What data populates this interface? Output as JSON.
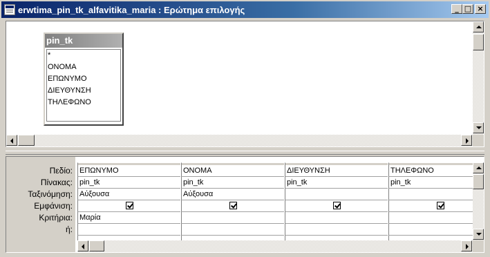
{
  "window": {
    "title": "erwtima_pin_tk_alfavitika_maria : Ερώτημα επιλογής",
    "minimize_label": "_",
    "maximize_label": "□",
    "close_label": "×"
  },
  "field_list": {
    "table_name": "pin_tk",
    "fields": [
      "*",
      "ΟΝΟΜΑ",
      "ΕΠΩΝΥΜΟ",
      "ΔΙΕΥΘΥΝΣΗ",
      "ΤΗΛΕΦΩΝΟ"
    ]
  },
  "grid": {
    "row_labels": [
      "Πεδίο:",
      "Πίνακας:",
      "Ταξινόμηση:",
      "Εμφάνιση:",
      "Κριτήρια:",
      "ή:"
    ],
    "columns": [
      {
        "field": "ΕΠΩΝΥΜΟ",
        "table": "pin_tk",
        "sort": "Αύξουσα",
        "show": true,
        "criteria": "Μαρία",
        "or": ""
      },
      {
        "field": "ΟΝΟΜΑ",
        "table": "pin_tk",
        "sort": "Αύξουσα",
        "show": true,
        "criteria": "",
        "or": ""
      },
      {
        "field": "ΔΙΕΥΘΥΝΣΗ",
        "table": "pin_tk",
        "sort": "",
        "show": true,
        "criteria": "",
        "or": ""
      },
      {
        "field": "ΤΗΛΕΦΩΝΟ",
        "table": "pin_tk",
        "sort": "",
        "show": true,
        "criteria": "",
        "or": ""
      }
    ]
  }
}
